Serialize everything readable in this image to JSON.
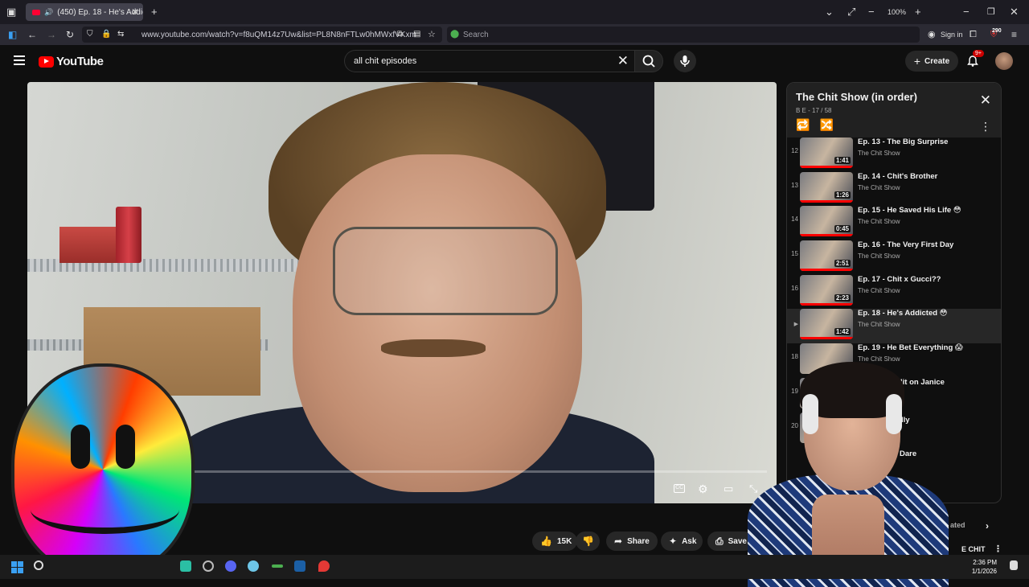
{
  "browser": {
    "tab_title": "(450) Ep. 18 - He's Addicted",
    "url": "www.youtube.com/watch?v=f8uQM14z7Uw&list=PL8N8nFTLw0hMWxfVKxm",
    "search_placeholder": "Search",
    "zoom": "100%",
    "sign_in": "Sign in",
    "extension_badge": "290"
  },
  "youtube": {
    "logo_text": "YouTube",
    "search_value": "all chit episodes",
    "create_label": "Create",
    "notification_count": "9+"
  },
  "playlist": {
    "title": "The Chit Show (in order)",
    "subtitle": "B E - 17 / 58",
    "items": [
      {
        "num": "12",
        "title": "Ep. 13 - The Big Surprise",
        "channel": "The Chit Show",
        "duration": "1:41",
        "active": false
      },
      {
        "num": "13",
        "title": "Ep. 14 - Chit's Brother",
        "channel": "The Chit Show",
        "duration": "1:26",
        "active": false
      },
      {
        "num": "14",
        "title": "Ep. 15 - He Saved His Life 😳",
        "channel": "The Chit Show",
        "duration": "0:45",
        "active": false
      },
      {
        "num": "15",
        "title": "Ep. 16 - The Very First Day",
        "channel": "The Chit Show",
        "duration": "2:51",
        "active": false
      },
      {
        "num": "16",
        "title": "Ep. 17 - Chit x Gucci??",
        "channel": "The Chit Show",
        "duration": "2:23",
        "active": false
      },
      {
        "num": "▶",
        "title": "Ep. 18 - He's Addicted 😳",
        "channel": "The Chit Show",
        "duration": "1:42",
        "active": true
      },
      {
        "num": "18",
        "title": "Ep. 19 - He Bet Everything 😱",
        "channel": "The Chit Show",
        "duration": "",
        "active": false
      },
      {
        "num": "19",
        "title": "He Hit on Janice",
        "channel": "",
        "duration": "",
        "active": false
      },
      {
        "num": "20",
        "title": "lly",
        "channel": "",
        "duration": "",
        "active": false
      },
      {
        "num": "",
        "title": "Dare",
        "channel": "",
        "duration": "",
        "active": false
      }
    ]
  },
  "actions": {
    "likes": "15K",
    "share": "Share",
    "ask": "Ask",
    "save": "Save"
  },
  "overlay": {
    "related_chip": "ated",
    "channel_frag": "E CHIT"
  },
  "video": {
    "cc": "CC"
  },
  "taskbar": {
    "time": "2:36 PM",
    "date": "1/1/2026"
  }
}
